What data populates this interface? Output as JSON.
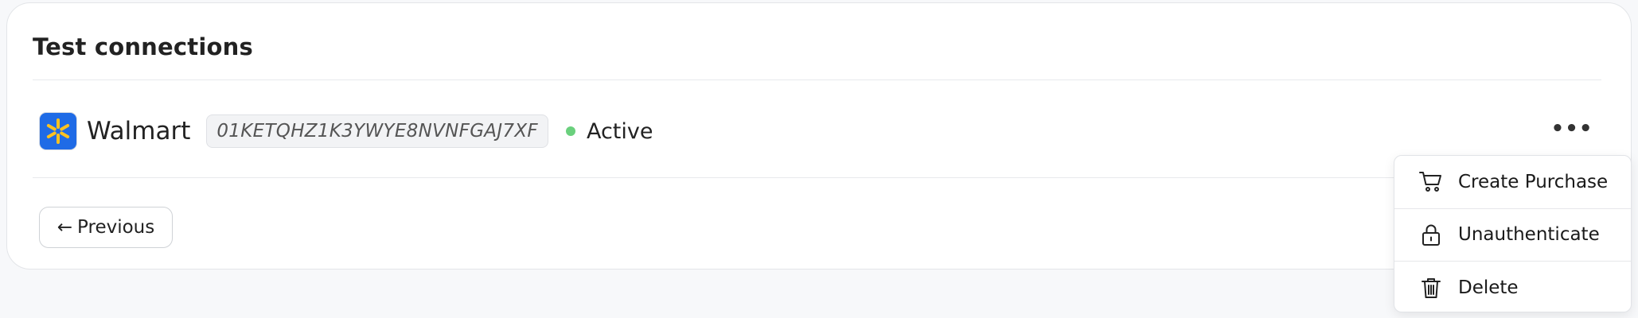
{
  "card": {
    "title": "Test connections"
  },
  "connection": {
    "name": "Walmart",
    "id": "01KETQHZ1K3YWYE8NVNFGAJ7XF",
    "status": "Active",
    "status_color": "#6ad07d",
    "logo_icon": "walmart-spark-icon",
    "logo_bg": "#1f6be6",
    "logo_spark_color": "#ffc220"
  },
  "actions": {
    "more_label": "•••",
    "previous_arrow": "←",
    "previous_label": "Previous"
  },
  "menu": {
    "items": [
      {
        "label": "Create Purchase",
        "icon": "cart-icon"
      },
      {
        "label": "Unauthenticate",
        "icon": "lock-icon"
      },
      {
        "label": "Delete",
        "icon": "trash-icon"
      }
    ]
  }
}
